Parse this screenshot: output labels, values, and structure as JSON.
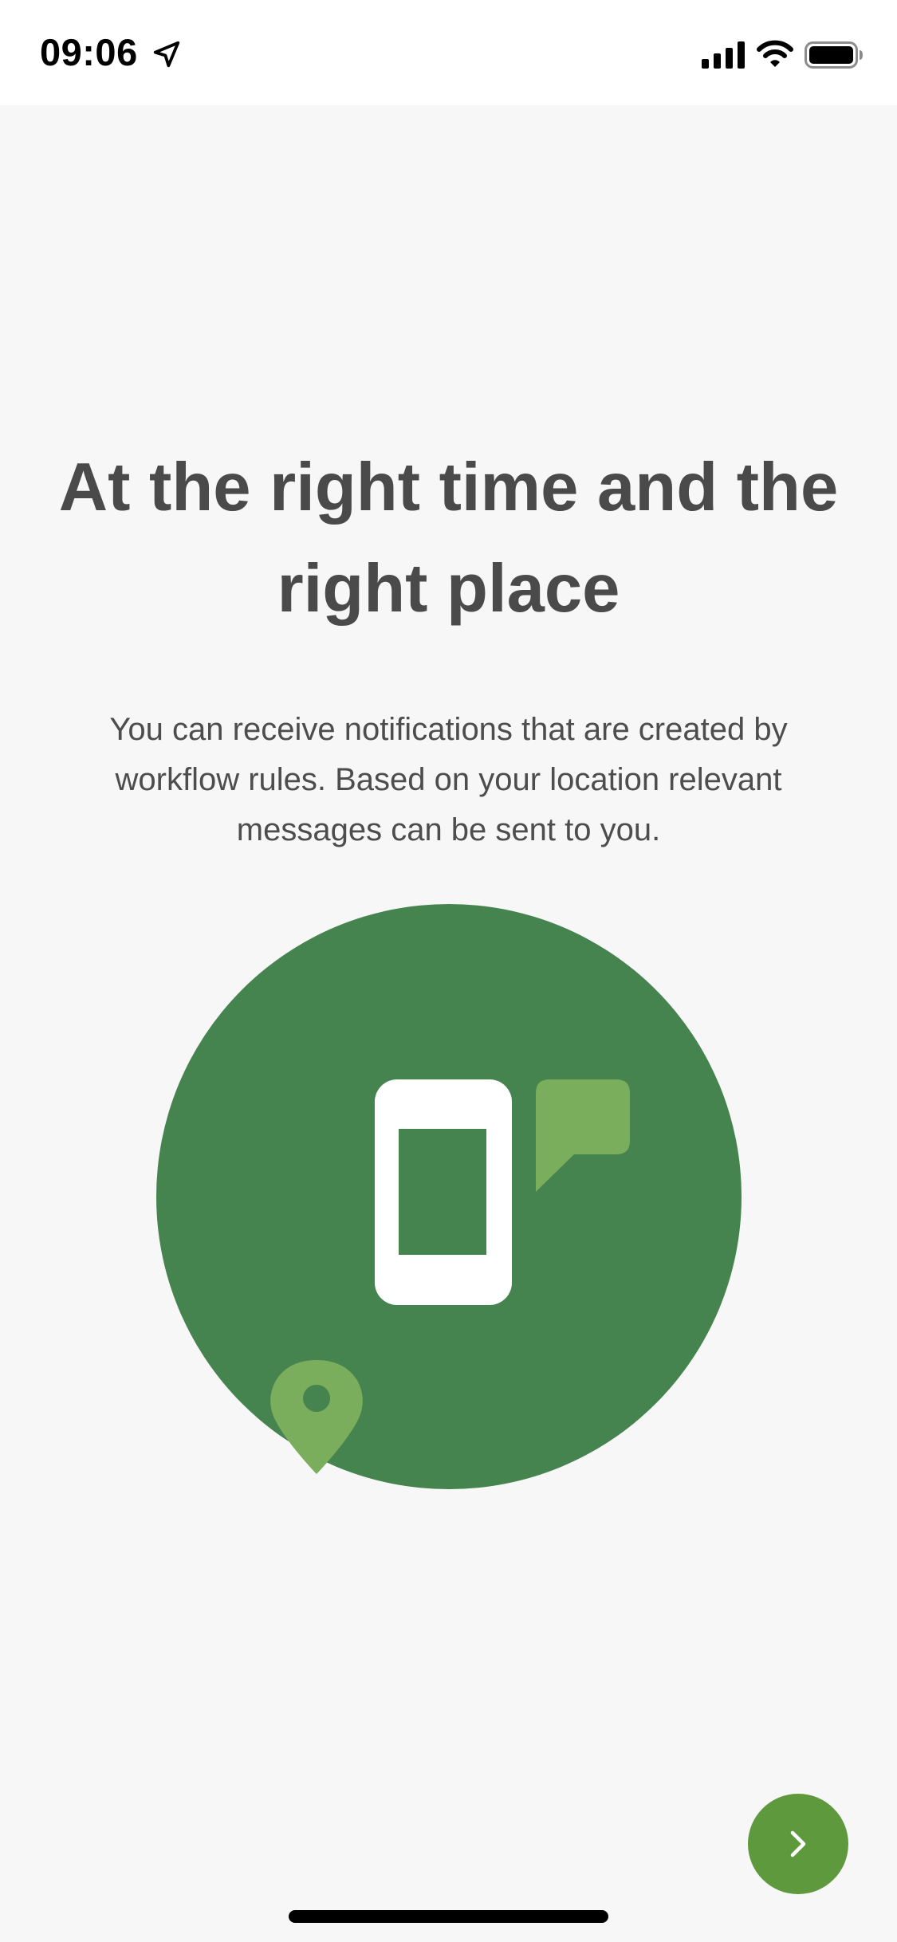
{
  "status_bar": {
    "time": "09:06",
    "icons": [
      "location-arrow-icon",
      "cellular-signal-icon",
      "wifi-icon",
      "battery-icon"
    ]
  },
  "onboarding": {
    "title": "At the right time and the right place",
    "description": "You can receive notifications that are created by workflow rules. Based on your location relevant messages can be sent to you.",
    "illustration_icons": [
      "phone-icon",
      "chat-bubble-icon",
      "location-pin-icon"
    ]
  },
  "colors": {
    "circle_green": "#45834f",
    "light_green": "#7aad5c",
    "button_green": "#5e9a3d",
    "text_gray": "#4a4a4a",
    "background": "#f7f7f7"
  },
  "navigation": {
    "next_icon": "chevron-right-icon"
  }
}
